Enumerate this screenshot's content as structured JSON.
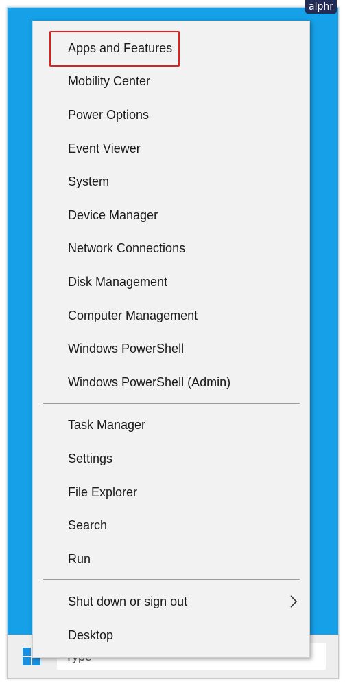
{
  "badge": {
    "text": "alphr"
  },
  "menu": {
    "group1": [
      {
        "label": "Apps and Features",
        "highlighted": true
      },
      {
        "label": "Mobility Center"
      },
      {
        "label": "Power Options"
      },
      {
        "label": "Event Viewer"
      },
      {
        "label": "System"
      },
      {
        "label": "Device Manager"
      },
      {
        "label": "Network Connections"
      },
      {
        "label": "Disk Management"
      },
      {
        "label": "Computer Management"
      },
      {
        "label": "Windows PowerShell"
      },
      {
        "label": "Windows PowerShell (Admin)"
      }
    ],
    "group2": [
      {
        "label": "Task Manager"
      },
      {
        "label": "Settings"
      },
      {
        "label": "File Explorer"
      },
      {
        "label": "Search"
      },
      {
        "label": "Run"
      }
    ],
    "group3": [
      {
        "label": "Shut down or sign out",
        "submenu_icon": "chevron-right-icon"
      },
      {
        "label": "Desktop"
      }
    ]
  },
  "taskbar": {
    "start_icon": "windows-logo-icon",
    "search_text": "Type"
  },
  "colors": {
    "desktop_bg": "#15a0e8",
    "menu_bg": "#f2f2f2",
    "highlight_border": "#e0201c",
    "badge_bg": "#232b57",
    "windows_logo": "#1a8fe0"
  }
}
